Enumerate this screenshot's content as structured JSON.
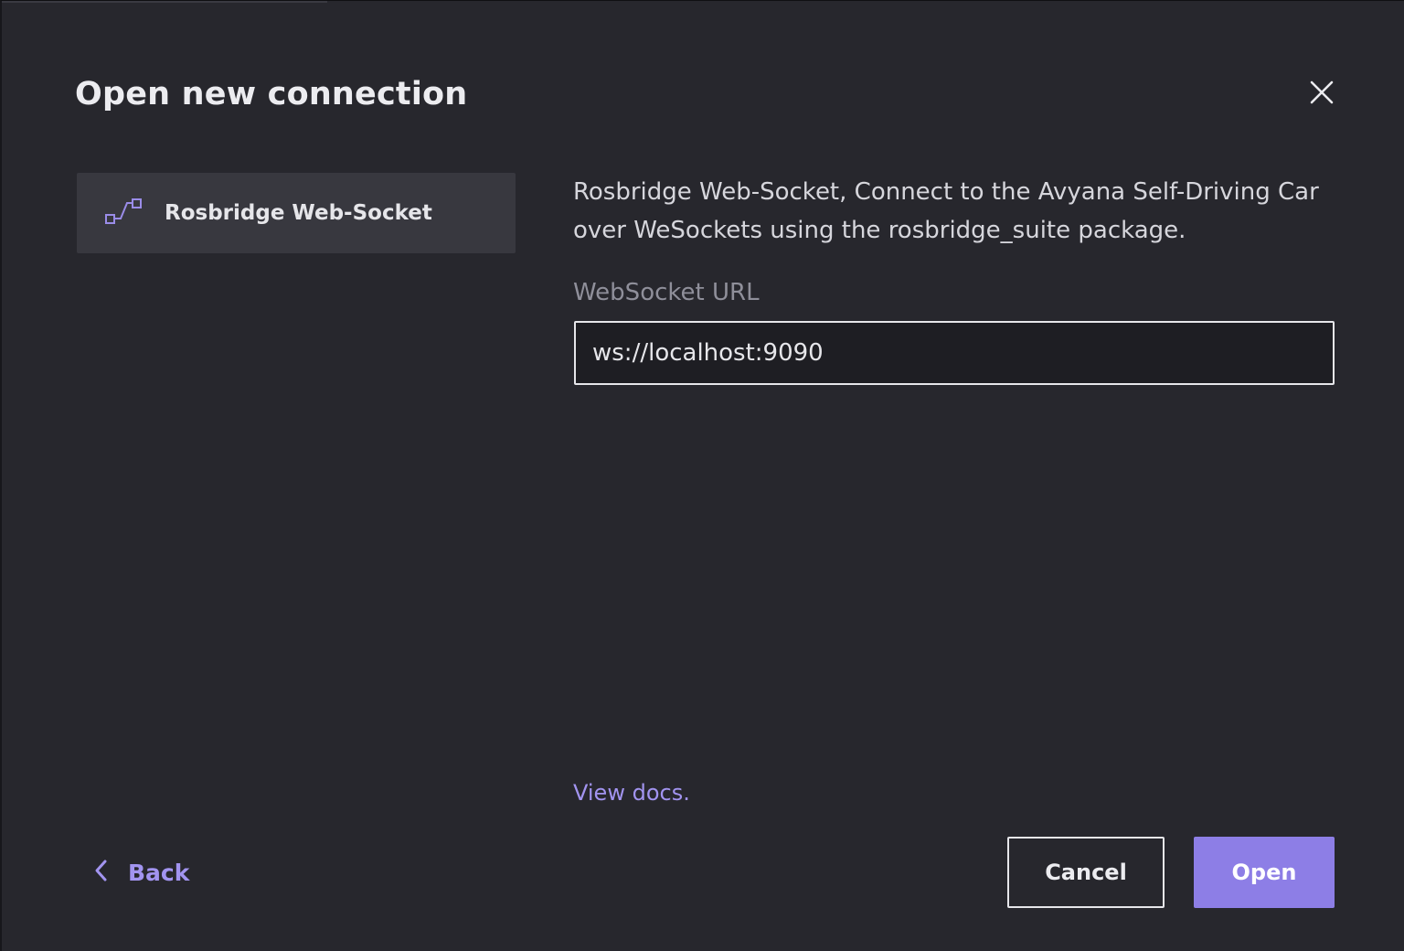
{
  "dialog": {
    "title": "Open new connection",
    "close_icon": "close-icon"
  },
  "sources": [
    {
      "label": "Rosbridge Web-Socket",
      "icon": "connection-nodes-icon",
      "selected": true
    }
  ],
  "details": {
    "description": "Rosbridge Web-Socket, Connect to the Avyana Self-Driving Car over WeSockets using the rosbridge_suite package.",
    "field_label": "WebSocket URL",
    "field_value": "ws://localhost:9090",
    "docs_link": "View docs."
  },
  "footer": {
    "back_label": "Back",
    "back_icon": "chevron-left-icon",
    "cancel_label": "Cancel",
    "open_label": "Open"
  },
  "colors": {
    "accent": "#8d7ee6",
    "link": "#a294f0",
    "background": "#27272d",
    "selected_item": "#38383f"
  }
}
